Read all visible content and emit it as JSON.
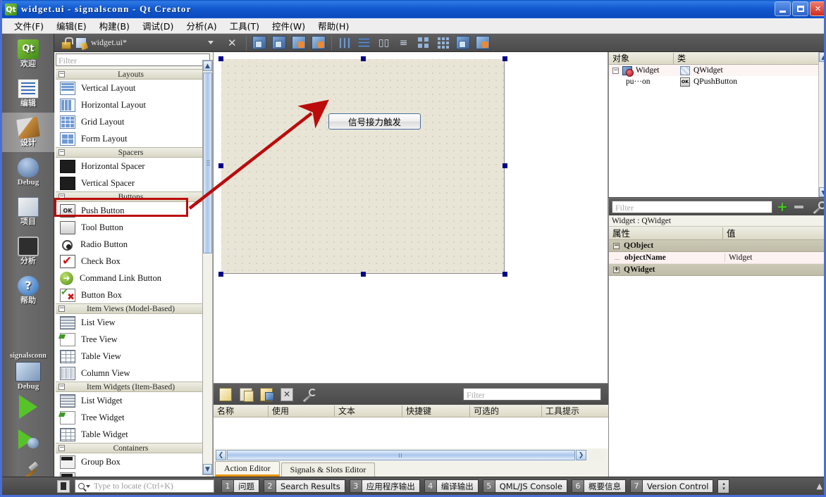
{
  "window": {
    "title": "widget.ui - signalsconn - Qt Creator",
    "icon": "qt-logo-icon",
    "minimize": "–",
    "maximize": "□",
    "close": "✕"
  },
  "menubar": {
    "items": [
      {
        "label": "文件(F)"
      },
      {
        "label": "编辑(E)"
      },
      {
        "label": "构建(B)"
      },
      {
        "label": "调试(D)"
      },
      {
        "label": "分析(A)"
      },
      {
        "label": "工具(T)"
      },
      {
        "label": "控件(W)"
      },
      {
        "label": "帮助(H)"
      }
    ]
  },
  "modebar": {
    "items": [
      {
        "label": "欢迎",
        "icon": "qt-welcome-icon",
        "active": false
      },
      {
        "label": "编辑",
        "icon": "edit-icon",
        "active": false
      },
      {
        "label": "设计",
        "icon": "design-icon",
        "active": true
      },
      {
        "label": "Debug",
        "icon": "debug-bug-icon",
        "active": false
      },
      {
        "label": "项目",
        "icon": "projects-icon",
        "active": false
      },
      {
        "label": "分析",
        "icon": "analyze-icon",
        "active": false
      },
      {
        "label": "帮助",
        "icon": "help-icon",
        "active": false
      }
    ],
    "kit": {
      "project": "signalsconn",
      "config": "Debug",
      "computer_icon": "computer-icon",
      "run_icon": "run-play-icon",
      "debug_icon": "start-debug-icon",
      "build_icon": "build-hammer-icon"
    }
  },
  "designer_toolbar": {
    "lock_icon": "lock-icon",
    "file_icon": "ui-file-icon",
    "document": "widget.ui*",
    "close_icon": "close-icon",
    "tools": [
      {
        "icon": "edit-widgets-icon"
      },
      {
        "icon": "edit-signals-slots-icon"
      },
      {
        "icon": "edit-buddies-icon"
      },
      {
        "icon": "edit-tab-order-icon"
      },
      {
        "icon": "layout-horizontally-icon"
      },
      {
        "icon": "layout-vertically-icon"
      },
      {
        "icon": "layout-in-splitter-h-icon"
      },
      {
        "icon": "layout-in-splitter-v-icon"
      },
      {
        "icon": "layout-form-icon"
      },
      {
        "icon": "layout-grid-icon"
      },
      {
        "icon": "break-layout-icon"
      },
      {
        "icon": "adjust-size-icon"
      }
    ]
  },
  "widget_box": {
    "filter_placeholder": "Filter",
    "scroll_up_icon": "chevron-up-icon",
    "scroll_down_icon": "chevron-down-icon",
    "categories": [
      {
        "name": "Layouts",
        "expander": "−",
        "items": [
          {
            "label": "Vertical Layout",
            "icon": "vertical-layout-icon"
          },
          {
            "label": "Horizontal Layout",
            "icon": "horizontal-layout-icon"
          },
          {
            "label": "Grid Layout",
            "icon": "grid-layout-icon"
          },
          {
            "label": "Form Layout",
            "icon": "form-layout-icon"
          }
        ]
      },
      {
        "name": "Spacers",
        "expander": "−",
        "items": [
          {
            "label": "Horizontal Spacer",
            "icon": "horizontal-spacer-icon"
          },
          {
            "label": "Vertical Spacer",
            "icon": "vertical-spacer-icon"
          }
        ]
      },
      {
        "name": "Buttons",
        "expander": "−",
        "items": [
          {
            "label": "Push Button",
            "icon": "push-button-icon",
            "highlighted": true
          },
          {
            "label": "Tool Button",
            "icon": "tool-button-icon"
          },
          {
            "label": "Radio Button",
            "icon": "radio-button-icon"
          },
          {
            "label": "Check Box",
            "icon": "check-box-icon"
          },
          {
            "label": "Command Link Button",
            "icon": "command-link-icon"
          },
          {
            "label": "Button Box",
            "icon": "button-box-icon"
          }
        ]
      },
      {
        "name": "Item Views (Model-Based)",
        "expander": "−",
        "items": [
          {
            "label": "List View",
            "icon": "list-view-icon"
          },
          {
            "label": "Tree View",
            "icon": "tree-view-icon"
          },
          {
            "label": "Table View",
            "icon": "table-view-icon"
          },
          {
            "label": "Column View",
            "icon": "column-view-icon"
          }
        ]
      },
      {
        "name": "Item Widgets (Item-Based)",
        "expander": "−",
        "items": [
          {
            "label": "List Widget",
            "icon": "list-widget-icon"
          },
          {
            "label": "Tree Widget",
            "icon": "tree-widget-icon"
          },
          {
            "label": "Table Widget",
            "icon": "table-widget-icon"
          }
        ]
      },
      {
        "name": "Containers",
        "expander": "−",
        "items": [
          {
            "label": "Group Box",
            "icon": "group-box-icon"
          }
        ]
      }
    ]
  },
  "canvas": {
    "form_button_text": "信号接力触发",
    "annotation_color": "#bb0b0b",
    "selection_handle_color": "#00008b"
  },
  "action_editor": {
    "toolbar": [
      {
        "icon": "new-action-icon"
      },
      {
        "icon": "copy-icon"
      },
      {
        "icon": "paste-icon"
      },
      {
        "icon": "delete-icon"
      },
      {
        "icon": "configure-wrench-icon"
      }
    ],
    "filter_placeholder": "Filter",
    "columns": [
      "名称",
      "使用",
      "文本",
      "快捷键",
      "可选的",
      "工具提示"
    ],
    "rows": [],
    "scroll_left_icon": "❮",
    "scroll_right_icon": "❯",
    "tabs": [
      {
        "label": "Action Editor",
        "active": true
      },
      {
        "label": "Signals & Slots Editor",
        "active": false
      }
    ]
  },
  "object_inspector": {
    "columns": [
      "对象",
      "类"
    ],
    "rows": [
      {
        "name": "Widget",
        "class": "QWidget",
        "expander": "−",
        "icon": "widget-icon",
        "class_icon": "qwidget-icon",
        "indent": 0
      },
      {
        "name": "pu···on",
        "class": "QPushButton",
        "expander": "",
        "icon": "",
        "class_icon": "qpushbutton-icon",
        "indent": 1
      }
    ],
    "scroll_up_icon": "chevron-up-icon",
    "scroll_down_icon": "chevron-down-icon"
  },
  "property_editor": {
    "filter_placeholder": "Filter",
    "add_icon": "plus-icon",
    "remove_icon": "minus-icon",
    "configure_icon": "wrench-icon",
    "subject": "Widget : QWidget",
    "columns": [
      "属性",
      "值"
    ],
    "groups": [
      {
        "name": "QObject",
        "expander": "−",
        "properties": [
          {
            "name": "objectName",
            "value": "Widget"
          }
        ]
      },
      {
        "name": "QWidget",
        "expander": "+",
        "properties": []
      }
    ]
  },
  "statusbar": {
    "toggle_sidebar_icon": "toggle-sidebar-icon",
    "locator_placeholder": "Type to locate (Ctrl+K)",
    "search_icon": "search-icon",
    "panes": [
      {
        "num": "1",
        "label": "问题"
      },
      {
        "num": "2",
        "label": "Search Results"
      },
      {
        "num": "3",
        "label": "应用程序输出"
      },
      {
        "num": "4",
        "label": "编译输出"
      },
      {
        "num": "5",
        "label": "QML/JS Console"
      },
      {
        "num": "6",
        "label": "概要信息"
      },
      {
        "num": "7",
        "label": "Version Control"
      }
    ],
    "spin_up": "▴",
    "spin_down": "▾",
    "collapse_icon": "▲"
  }
}
